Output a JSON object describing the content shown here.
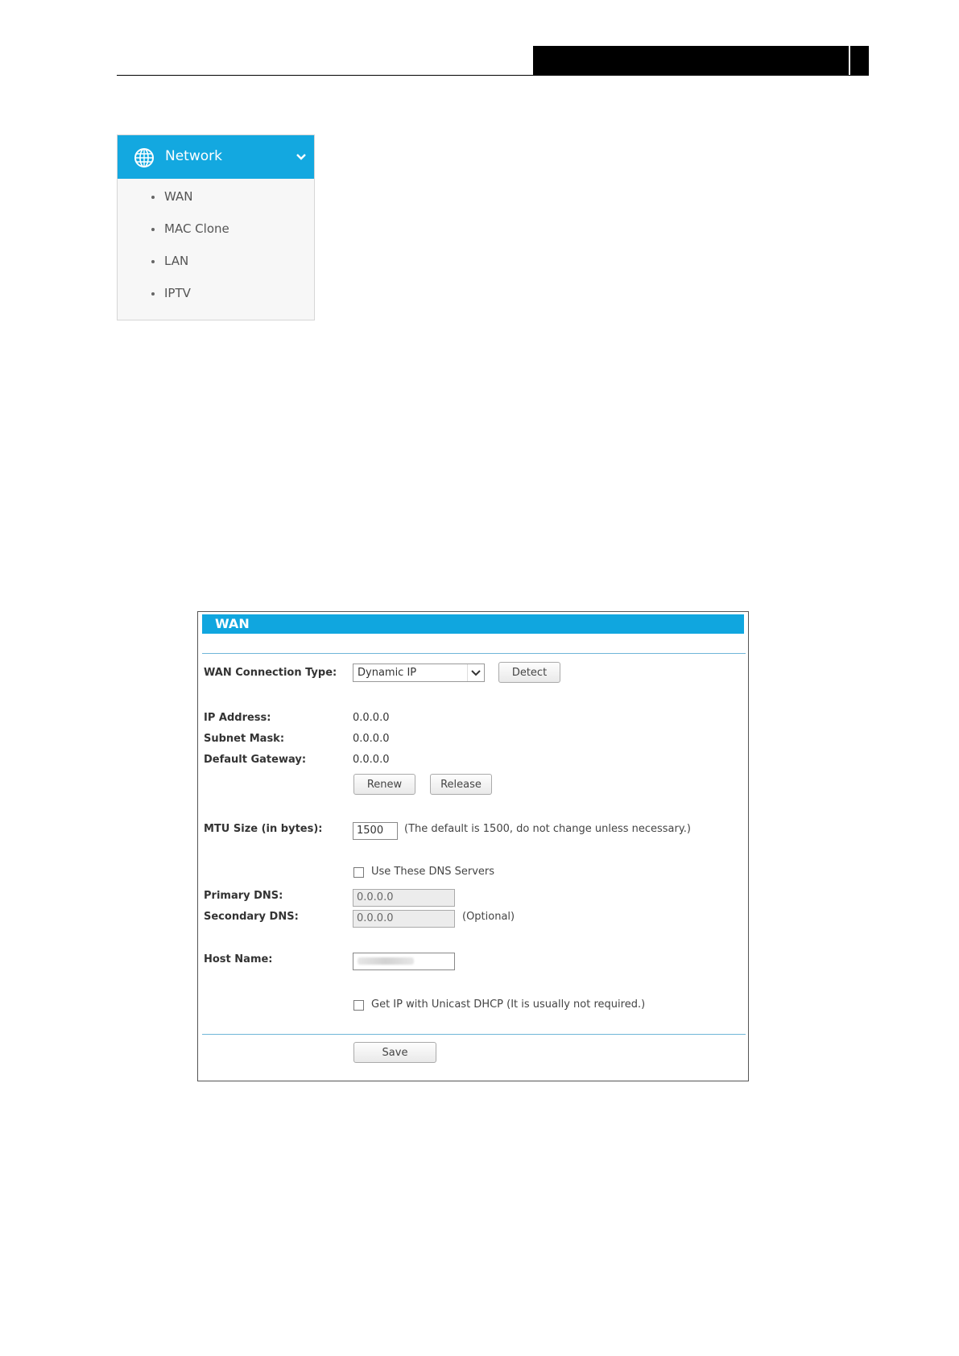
{
  "menu": {
    "title": "Network",
    "icon": "globe-icon",
    "accent_color": "#13a8e0",
    "items": [
      {
        "label": "WAN"
      },
      {
        "label": "MAC Clone"
      },
      {
        "label": "LAN"
      },
      {
        "label": "IPTV"
      }
    ]
  },
  "wan": {
    "title": "WAN",
    "connection_type_label": "WAN Connection Type:",
    "connection_type_value": "Dynamic IP",
    "detect_button": "Detect",
    "ip_address_label": "IP Address:",
    "ip_address_value": "0.0.0.0",
    "subnet_mask_label": "Subnet Mask:",
    "subnet_mask_value": "0.0.0.0",
    "default_gateway_label": "Default Gateway:",
    "default_gateway_value": "0.0.0.0",
    "renew_button": "Renew",
    "release_button": "Release",
    "mtu_label": "MTU Size (in bytes):",
    "mtu_value": "1500",
    "mtu_note": "(The default is 1500, do not change unless necessary.)",
    "use_dns_label": "Use These DNS Servers",
    "primary_dns_label": "Primary DNS:",
    "primary_dns_value": "0.0.0.0",
    "secondary_dns_label": "Secondary DNS:",
    "secondary_dns_value": "0.0.0.0",
    "optional_note": "(Optional)",
    "host_name_label": "Host Name:",
    "unicast_label": "Get IP with Unicast DHCP (It is usually not required.)",
    "save_button": "Save"
  }
}
